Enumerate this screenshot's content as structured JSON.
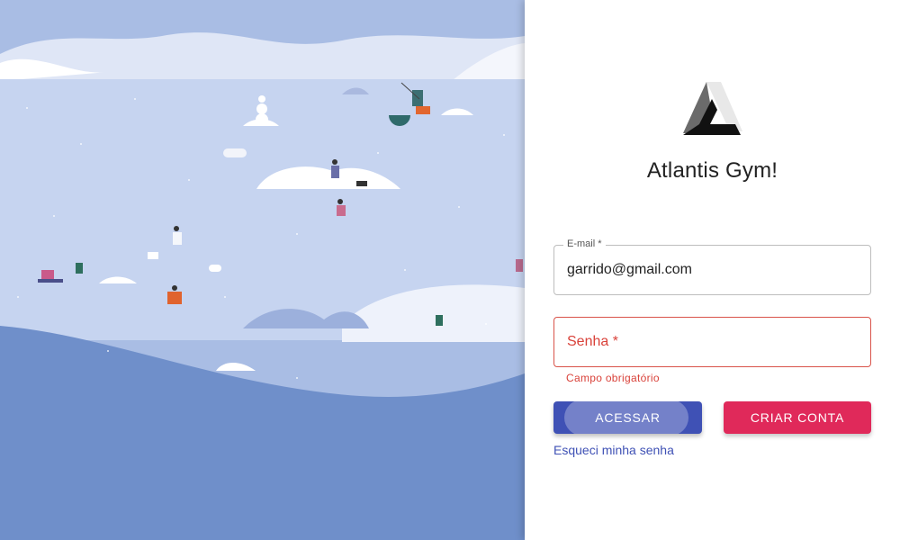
{
  "app": {
    "title": "Atlantis Gym!"
  },
  "form": {
    "email": {
      "label": "E-mail *",
      "value": "garrido@gmail.com"
    },
    "password": {
      "label": "Senha *",
      "error": "Campo obrigatório"
    },
    "login_button": "ACESSAR",
    "signup_button": "CRIAR CONTA",
    "forgot_link": "Esqueci minha senha"
  },
  "colors": {
    "primary": "#3f51b5",
    "accent": "#e0295a",
    "error": "#d9423a",
    "illustration_sky": "#c9d6f0",
    "illustration_water": "#6f8fca"
  },
  "icons": {
    "logo": "triangle-logo-icon"
  }
}
